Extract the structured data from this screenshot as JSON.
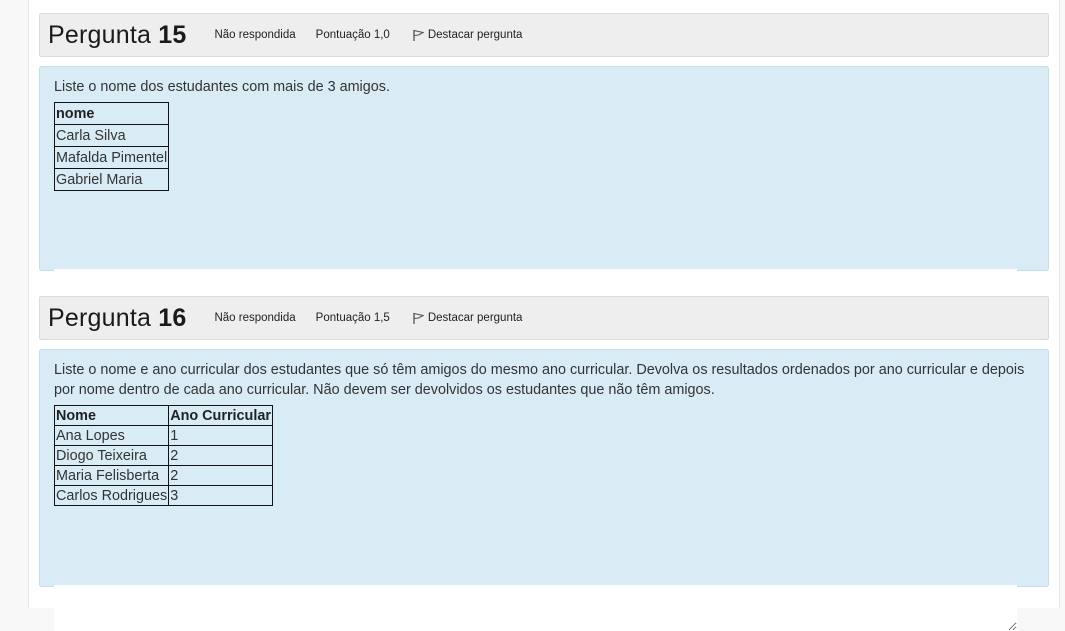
{
  "questions": [
    {
      "title_prefix": "Pergunta",
      "number": "15",
      "status": "Não respondida",
      "score": "Pontuação 1,0",
      "flag_label": "Destacar pergunta",
      "prompt": "Liste o nome dos estudantes com mais de 3 amigos.",
      "table": {
        "headers": [
          "nome"
        ],
        "rows": [
          [
            "Carla Silva"
          ],
          [
            "Mafalda Pimentel"
          ],
          [
            "Gabriel Maria"
          ]
        ]
      },
      "answer_value": ""
    },
    {
      "title_prefix": "Pergunta",
      "number": "16",
      "status": "Não respondida",
      "score": "Pontuação 1,5",
      "flag_label": "Destacar pergunta",
      "prompt": "Liste o nome e ano curricular dos estudantes que só têm amigos do mesmo ano curricular. Devolva os resultados ordenados por ano curricular e depois por nome dentro de cada ano curricular. Não devem ser devolvidos os estudantes que não têm amigos.",
      "table": {
        "headers": [
          "Nome",
          "Ano Curricular"
        ],
        "rows": [
          [
            "Ana Lopes",
            "1"
          ],
          [
            "Diogo Teixeira",
            "2"
          ],
          [
            "Maria Felisberta",
            "2"
          ],
          [
            "Carlos Rodrigues",
            "3"
          ]
        ]
      },
      "answer_value": ""
    }
  ],
  "icons": {
    "flag": "flag-icon"
  },
  "colors": {
    "question_bg": "#d9ecf6",
    "header_bg": "#eeeeee"
  }
}
